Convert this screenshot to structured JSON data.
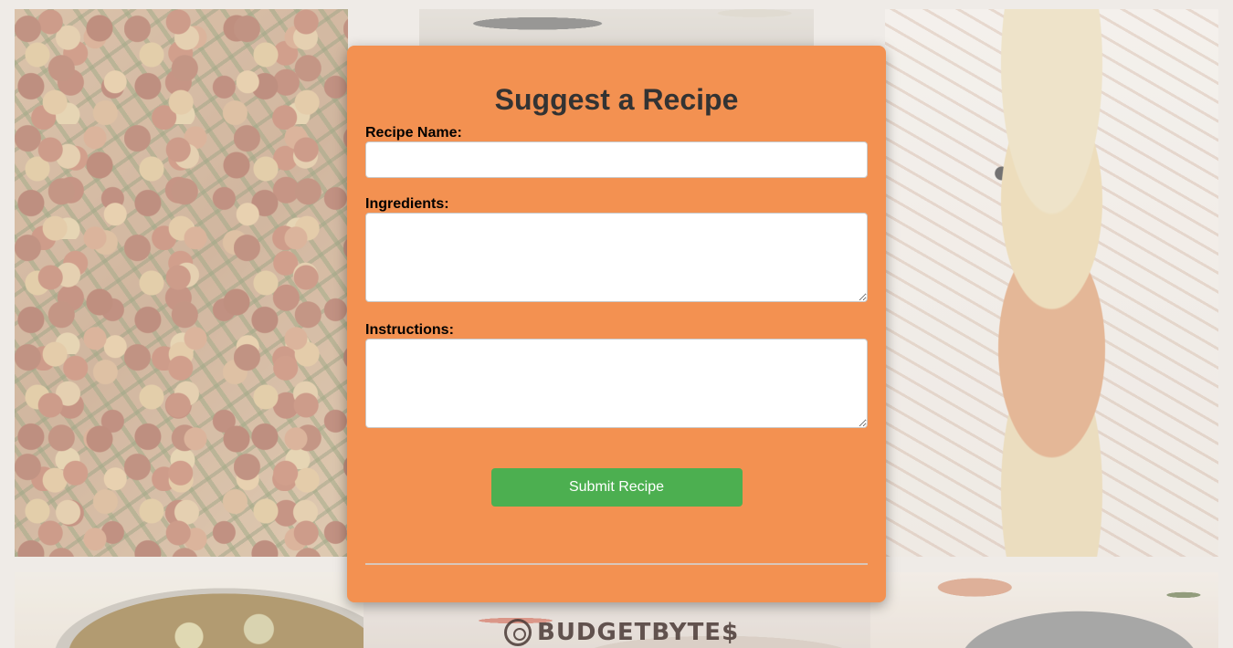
{
  "form": {
    "title": "Suggest a Recipe",
    "recipe_name_label": "Recipe Name:",
    "recipe_name_value": "",
    "ingredients_label": "Ingredients:",
    "ingredients_value": "",
    "instructions_label": "Instructions:",
    "instructions_value": "",
    "submit_label": "Submit Recipe"
  },
  "brand": {
    "logo_text": "BUDGETBYTE$"
  },
  "colors": {
    "card_background": "#f39151",
    "submit_button": "#4caf50",
    "title_text": "#333333"
  }
}
